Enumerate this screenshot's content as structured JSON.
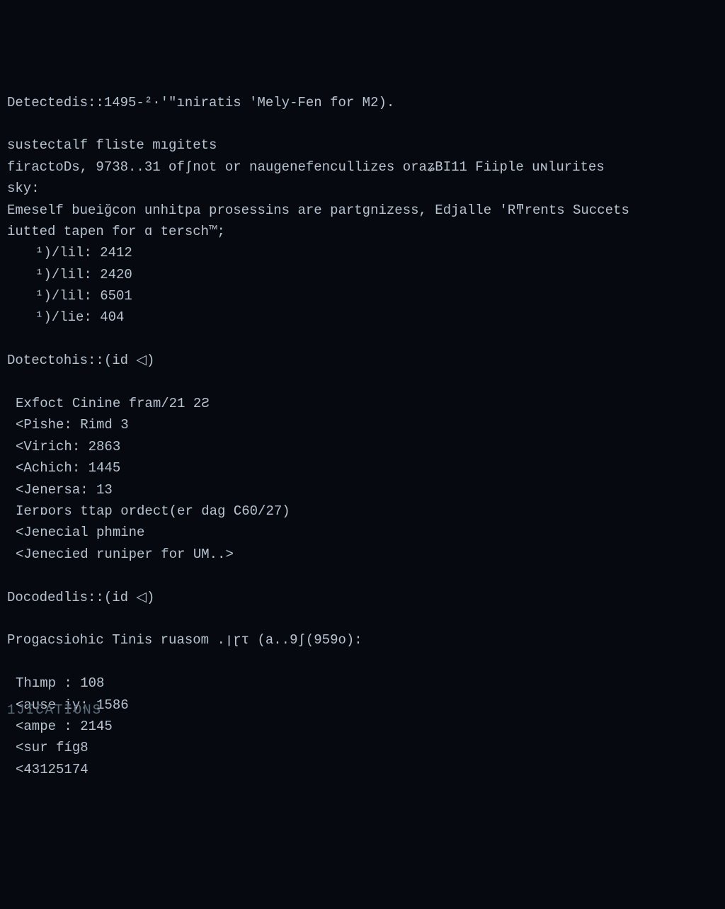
{
  "lines": [
    {
      "cls": "",
      "text": "Detectedis::1495-²·'\"ıniratis 'Mely-Fen for M2)."
    },
    {
      "cls": "",
      "text": ""
    },
    {
      "cls": "",
      "text": "sustectalf fliste mıgitets"
    },
    {
      "cls": "",
      "text": "firactoDs, 9738..31 ofʃnot or naugenefencullizes oraʑBI11 Fiiple uɴlurites"
    },
    {
      "cls": "",
      "text": "sky:"
    },
    {
      "cls": "",
      "text": "Emeself bueiğcon unhitpa prosessins are partgnizess, Edjalle 'Rͳrents Succets"
    },
    {
      "cls": "",
      "text": "iutted tapen for ɑ tersch™;"
    },
    {
      "cls": "indent1",
      "text": "¹)/lil: 2412"
    },
    {
      "cls": "indent1",
      "text": "¹)/lil: 2420"
    },
    {
      "cls": "indent1",
      "text": "¹)/lil: 6501"
    },
    {
      "cls": "indent1",
      "text": "¹)/lie: 404"
    },
    {
      "cls": "",
      "text": ""
    },
    {
      "cls": "",
      "text": "Dotectohis::(id ◁)"
    },
    {
      "cls": "",
      "text": ""
    },
    {
      "cls": "indent-s",
      "text": "Exfoct Cinine fram/21 2Ƨ"
    },
    {
      "cls": "indent-s",
      "text": "<Pishe: Rimd 3"
    },
    {
      "cls": "indent-s",
      "text": "<Virich: 2863"
    },
    {
      "cls": "indent-s",
      "text": "<Achich: 1445"
    },
    {
      "cls": "indent-s",
      "text": "<Jenersa: 13"
    },
    {
      "cls": "indent-s",
      "text": "Ierɒors ttap ordect(er dag C60/27)"
    },
    {
      "cls": "indent-s",
      "text": "<Jenecial phmine"
    },
    {
      "cls": "indent-s",
      "text": "<Jenecied runiper for UM..>"
    },
    {
      "cls": "",
      "text": ""
    },
    {
      "cls": "",
      "text": "Docodedlis::(id ◁)"
    },
    {
      "cls": "",
      "text": ""
    },
    {
      "cls": "",
      "text": "Progacsiohic Tinis ruasom .ןɽτ (a..9ʃ(959ᴏ):"
    },
    {
      "cls": "",
      "text": ""
    },
    {
      "cls": "indent-s",
      "text": "Thımp : 108"
    },
    {
      "cls": "indent-s",
      "text": "<ause iy: 1586"
    },
    {
      "cls": "indent-s",
      "text": "<ampe : 2145"
    },
    {
      "cls": "indent-s",
      "text": "<sur fíg8"
    },
    {
      "cls": "indent-s",
      "text": "<43125174"
    }
  ],
  "footer": "1JICATIONS"
}
